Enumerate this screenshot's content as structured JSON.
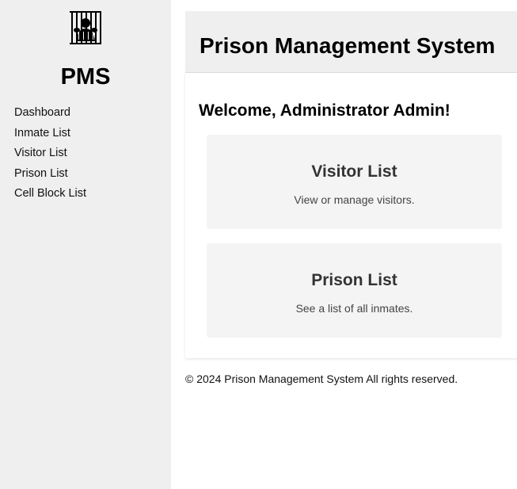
{
  "sidebar": {
    "brand": "PMS",
    "logo_icon": "prison-bars-icon",
    "nav": [
      {
        "label": "Dashboard"
      },
      {
        "label": "Inmate List"
      },
      {
        "label": "Visitor List"
      },
      {
        "label": "Prison List"
      },
      {
        "label": "Cell Block List"
      }
    ]
  },
  "header": {
    "title": "Prison Management System"
  },
  "main": {
    "welcome": "Welcome, Administrator Admin!",
    "cards": [
      {
        "title": "Visitor List",
        "description": "View or manage visitors."
      },
      {
        "title": "Prison List",
        "description": "See a list of all inmates."
      }
    ]
  },
  "footer": {
    "text": "© 2024 Prison Management System All rights reserved."
  },
  "colors": {
    "sidebar_bg": "#efefef",
    "header_bg": "#efefef",
    "card_bg": "#f4f4f4"
  }
}
